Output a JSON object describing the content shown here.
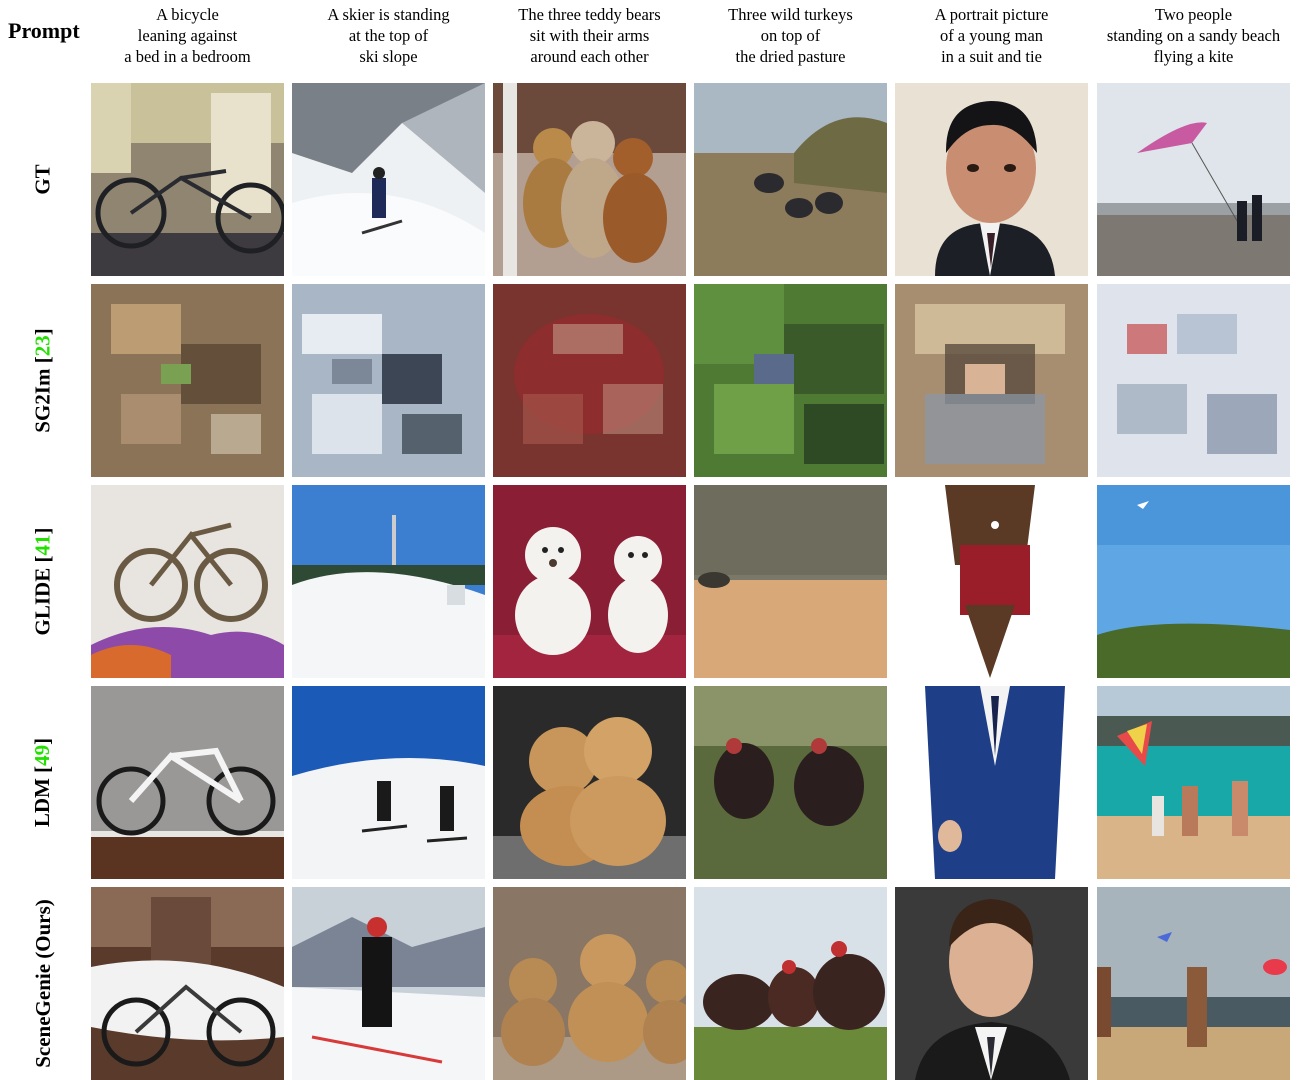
{
  "corner_label": "Prompt",
  "prompts": [
    [
      "A bicycle",
      "leaning against",
      "a bed in a bedroom"
    ],
    [
      "A skier is standing",
      "at the top of",
      "ski slope"
    ],
    [
      "The three teddy bears",
      "sit with their arms",
      "around each other"
    ],
    [
      "Three wild turkeys",
      "on top of",
      "the dried pasture"
    ],
    [
      "A portrait picture",
      "of a young man",
      "in a suit and tie"
    ],
    [
      "Two people",
      "standing on a sandy beach",
      "flying a kite"
    ]
  ],
  "rows": [
    {
      "name": "GT",
      "cite": "",
      "cite_color": "#22e000"
    },
    {
      "name": "SG2Im [",
      "cite": "23",
      "suffix": "]",
      "cite_color": "#22e000"
    },
    {
      "name": "GLIDE [",
      "cite": "41",
      "suffix": "]",
      "cite_color": "#22e000"
    },
    {
      "name": "LDM [",
      "cite": "49",
      "suffix": "]",
      "cite_color": "#22e000"
    },
    {
      "name": "SceneGenie (Ours)",
      "cite": ""
    }
  ]
}
